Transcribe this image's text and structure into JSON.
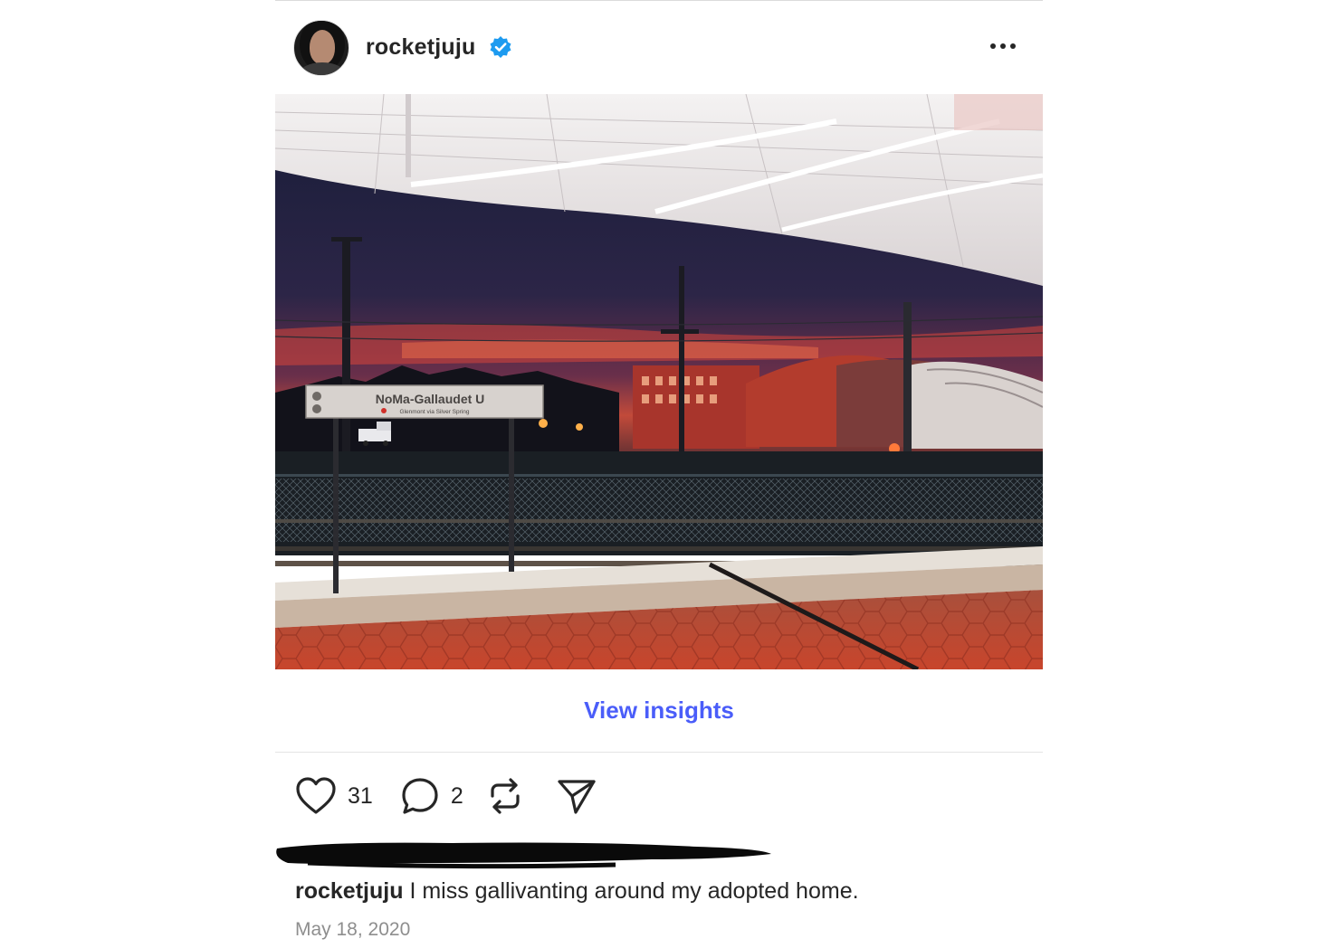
{
  "post": {
    "username": "rocketjuju",
    "verified": true,
    "menu_icon": "more-horizontal-icon"
  },
  "photo": {
    "station_sign": {
      "name": "NoMa-Gallaudet U",
      "subline": "Glenmont via Silver Spring"
    }
  },
  "insights": {
    "label": "View insights",
    "color": "#4a5df9"
  },
  "actions": {
    "likes": "31",
    "comments": "2",
    "icons": [
      "heart-icon",
      "comment-icon",
      "repost-icon",
      "share-icon"
    ]
  },
  "caption": {
    "username": "rocketjuju",
    "text": "I miss gallivanting around my adopted home."
  },
  "date": "May 18, 2020"
}
